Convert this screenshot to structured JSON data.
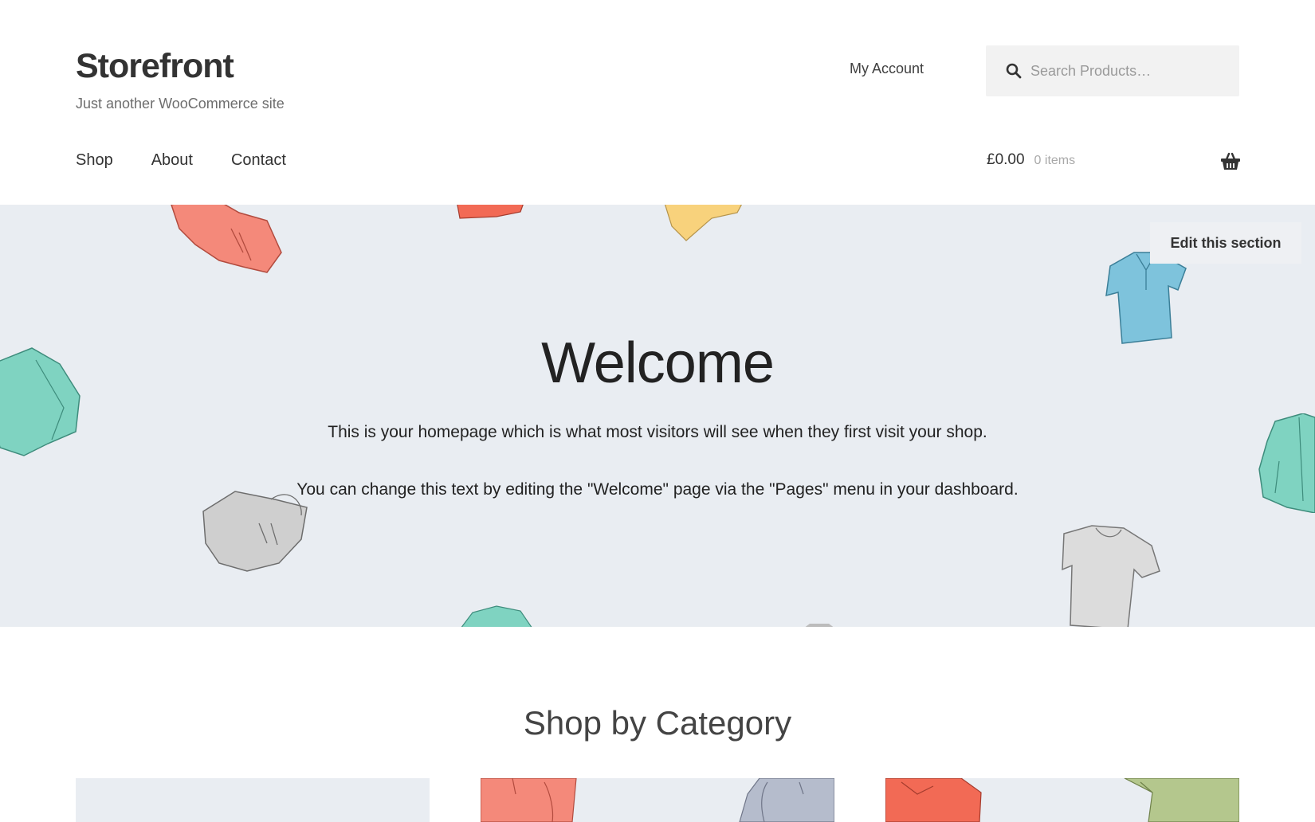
{
  "header": {
    "site_title": "Storefront",
    "tagline": "Just another WooCommerce site",
    "account_link": "My Account",
    "search": {
      "placeholder": "Search Products…"
    },
    "nav": [
      "Shop",
      "About",
      "Contact"
    ],
    "cart": {
      "amount": "£0.00",
      "count": "0 items"
    },
    "icons": {
      "search": "search-icon",
      "cart": "basket-icon"
    }
  },
  "hero": {
    "edit_label": "Edit this section",
    "title": "Welcome",
    "paragraph_1": "This is your homepage which is what most visitors will see when they first visit your shop.",
    "paragraph_2": "You can change this text by editing the \"Welcome\" page via the \"Pages\" menu in your dashboard.",
    "background_color": "#e9edf2",
    "garment_colors": {
      "coral": "#f4897a",
      "yellow": "#f8d27c",
      "teal": "#7fd3c1",
      "blue": "#7ec3dc",
      "grey": "#c9c9c9",
      "green": "#b4c78d",
      "slate": "#b5bccc"
    }
  },
  "categories": {
    "title": "Shop by Category"
  }
}
